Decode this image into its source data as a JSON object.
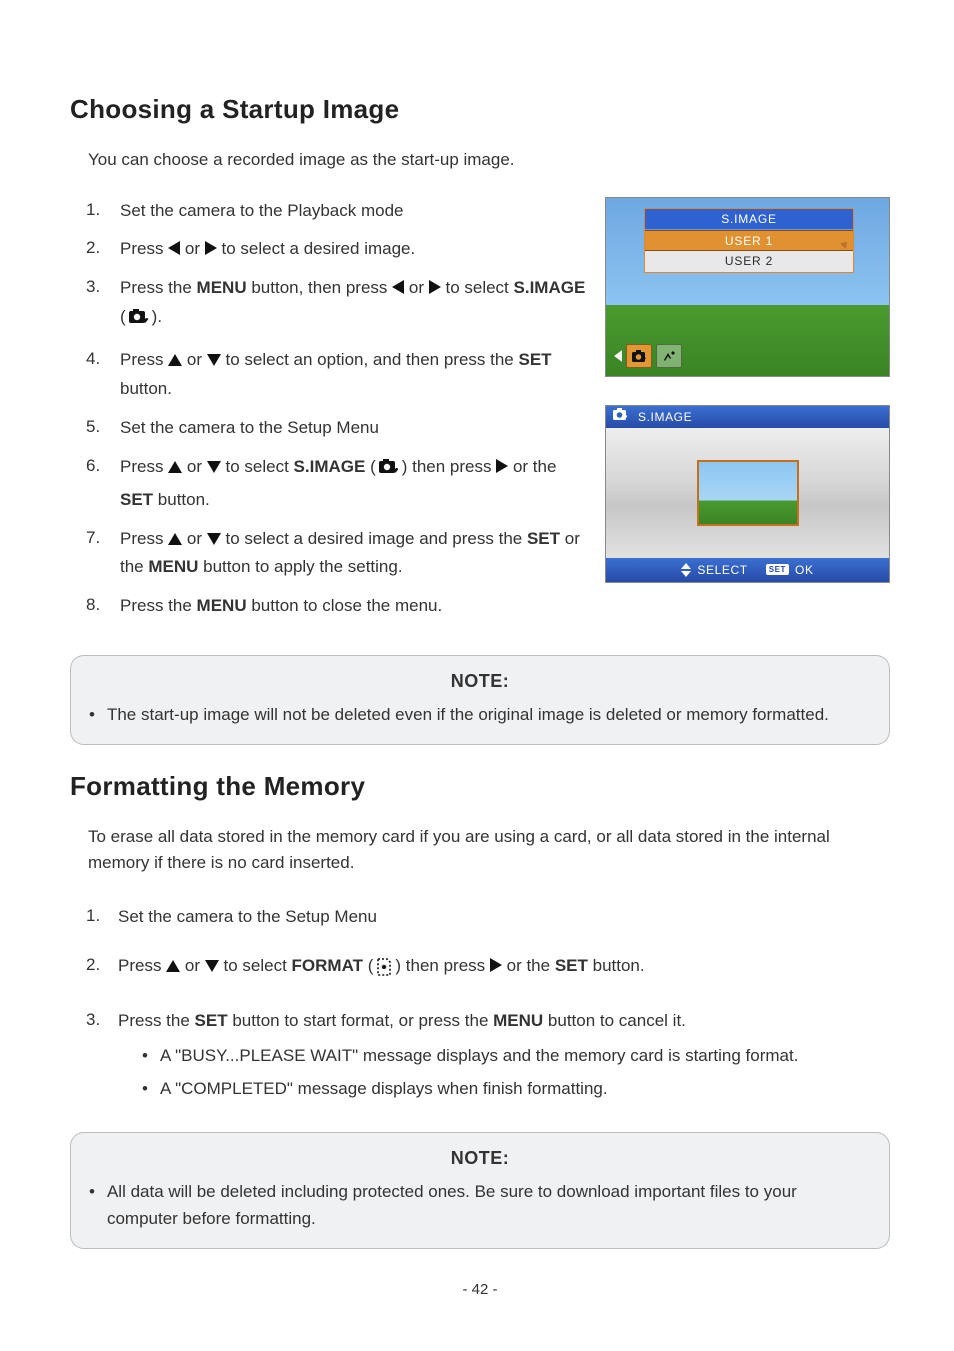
{
  "section1": {
    "heading": "Choosing a Startup Image",
    "intro": "You can choose a recorded image as the start-up image.",
    "steps": {
      "s1": {
        "n": "1.",
        "t": "Set the camera to the Playback mode"
      },
      "s2": {
        "n": "2.",
        "a": "Press ",
        "b": " or ",
        "c": " to select a desired image."
      },
      "s3": {
        "n": "3.",
        "a": "Press the ",
        "menu": "MENU",
        "b": " button, then press ",
        "c": " or ",
        "d": " to select ",
        "simage": "S.IMAGE",
        "e": " (",
        "f": ")."
      },
      "s4": {
        "n": "4.",
        "a": "Press ",
        "b": " or ",
        "c": " to select an option, and then press the ",
        "set": "SET",
        "d": " button."
      },
      "s5": {
        "n": "5.",
        "t": "Set the camera to the Setup Menu"
      },
      "s6": {
        "n": "6.",
        "a": "Press ",
        "b": " or ",
        "c": " to select ",
        "simage": "S.IMAGE",
        "d": " (",
        "e": ") then press ",
        "f": " or the ",
        "set": "SET",
        "g": " button."
      },
      "s7": {
        "n": "7.",
        "a": "Press ",
        "b": " or ",
        "c": " to select a desired image and press the ",
        "set": "SET",
        "d": " or the ",
        "menu": "MENU",
        "e": " button to apply the setting."
      },
      "s8": {
        "n": "8.",
        "a": "Press the ",
        "menu": "MENU",
        "b": " button to close the menu."
      }
    },
    "note": {
      "title": "NOTE:",
      "item": "The start-up image will not be deleted even if the original image is deleted or memory formatted."
    }
  },
  "screens": {
    "s1": {
      "title": "S.IMAGE",
      "opt1": "USER 1",
      "opt2": "USER 2"
    },
    "s2": {
      "title": "S.IMAGE",
      "select": "SELECT",
      "set": "SET",
      "ok": "OK"
    }
  },
  "section2": {
    "heading": "Formatting the Memory",
    "intro": "To erase all data stored in the memory card if you are using a card, or all data stored in the internal memory if there is no card inserted.",
    "s1": {
      "n": "1.",
      "t": "Set the camera to the Setup Menu"
    },
    "s2": {
      "n": "2.",
      "a": "Press ",
      "b": " or ",
      "c": " to select ",
      "format": "FORMAT",
      "d": " (",
      "e": ") then press ",
      "f": " or the ",
      "set": "SET",
      "g": " button."
    },
    "s3": {
      "n": "3.",
      "a": "Press the ",
      "set": "SET",
      "b": " button to start format, or press the ",
      "menu": "MENU",
      "c": " button to cancel it.",
      "sub1": "A \"BUSY...PLEASE WAIT\" message displays and the memory card is starting format.",
      "sub2": "A \"COMPLETED\" message displays when finish formatting."
    },
    "note": {
      "title": "NOTE:",
      "item": "All data will be deleted including protected ones. Be sure to download important files to your computer before formatting."
    }
  },
  "page": "- 42 -"
}
